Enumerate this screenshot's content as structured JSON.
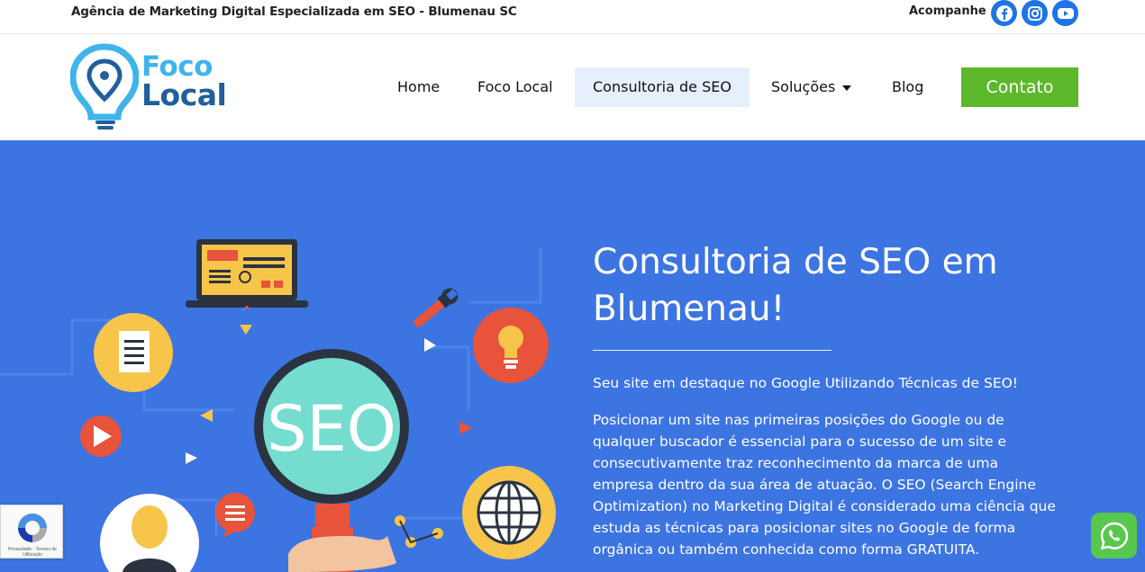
{
  "topbar": {
    "tagline": "Agência de Marketing Digital Especializada em SEO - Blumenau SC",
    "follow_label": "Acompanhe",
    "social": [
      "facebook-icon",
      "instagram-icon",
      "youtube-icon"
    ]
  },
  "header": {
    "logo_line1": "Foco",
    "logo_line2": "Local",
    "nav": {
      "home": "Home",
      "foco_local": "Foco Local",
      "consultoria": "Consultoria de SEO",
      "solucoes": "Soluções",
      "blog": "Blog"
    },
    "contact_label": "Contato"
  },
  "hero": {
    "title": "Consultoria de SEO em Blumenau!",
    "subtitle": "Seu site em destaque no Google Utilizando Técnicas de SEO!",
    "body": "Posicionar um site nas primeiras posições do Google ou de qualquer buscador é essencial para o sucesso de um site e consecutivamente traz reconhecimento da marca de uma empresa dentro da sua área de atuação. O SEO (Search Engine Optimization) no Marketing Digital é considerado uma ciência que estuda as técnicas para posicionar sites no Google de forma orgânica ou também conhecida como forma GRATUITA.",
    "illustration_text": "SEO"
  },
  "recaptcha": {
    "text": "Privacidade - Termos de Utilização"
  },
  "colors": {
    "hero_bg": "#3c74e2",
    "contact_button": "#5cb82a",
    "active_nav_bg": "#e6effb",
    "social_blue": "#1e73e8",
    "whatsapp": "#57c84d"
  }
}
